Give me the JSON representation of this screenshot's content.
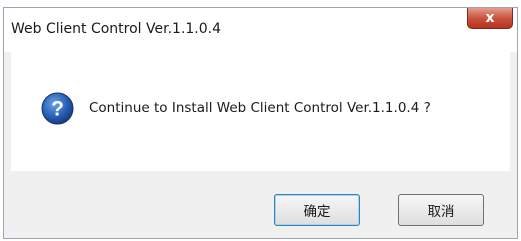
{
  "window": {
    "title": "Web Client Control Ver.1.1.0.4",
    "close_label": "x"
  },
  "dialog": {
    "icon": "question-icon",
    "message": "Continue to Install Web Client Control Ver.1.1.0.4 ?"
  },
  "buttons": {
    "ok_label": "确定",
    "cancel_label": "取消"
  },
  "colors": {
    "icon_blue": "#2a63b8",
    "close_red": "#c9503b"
  }
}
